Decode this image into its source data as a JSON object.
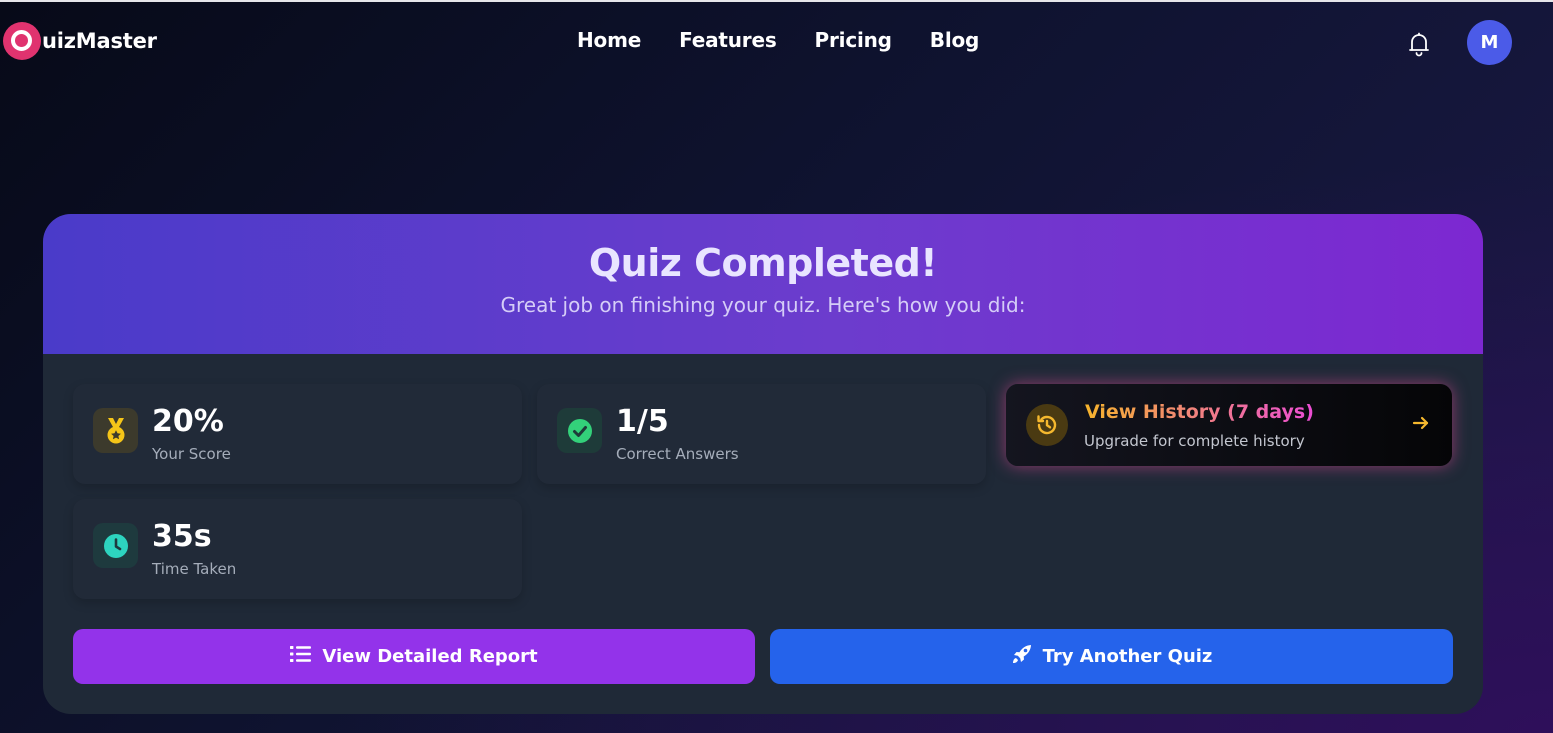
{
  "header": {
    "logo_text": "uizMaster",
    "nav": [
      "Home",
      "Features",
      "Pricing",
      "Blog"
    ],
    "avatar_initial": "M"
  },
  "result": {
    "title": "Quiz Completed!",
    "subtitle": "Great job on finishing your quiz. Here's how you did:",
    "stats": [
      {
        "value": "20%",
        "label": "Your Score",
        "icon": "medal-icon"
      },
      {
        "value": "1/5",
        "label": "Correct Answers",
        "icon": "check-circle-icon"
      },
      {
        "value": "35s",
        "label": "Time Taken",
        "icon": "clock-icon"
      }
    ],
    "history": {
      "title": "View History (7 days)",
      "subtitle": "Upgrade for complete history"
    },
    "buttons": {
      "report": "View Detailed Report",
      "try": "Try Another Quiz"
    }
  },
  "colors": {
    "logo_accent": "#e0336f",
    "header_gradient_start": "#4a3bc9",
    "header_gradient_end": "#7d28d1",
    "report_button": "#9333ea",
    "try_button": "#2563eb",
    "history_gradient_start": "#f6b42c",
    "history_gradient_end": "#ec4dd5"
  }
}
